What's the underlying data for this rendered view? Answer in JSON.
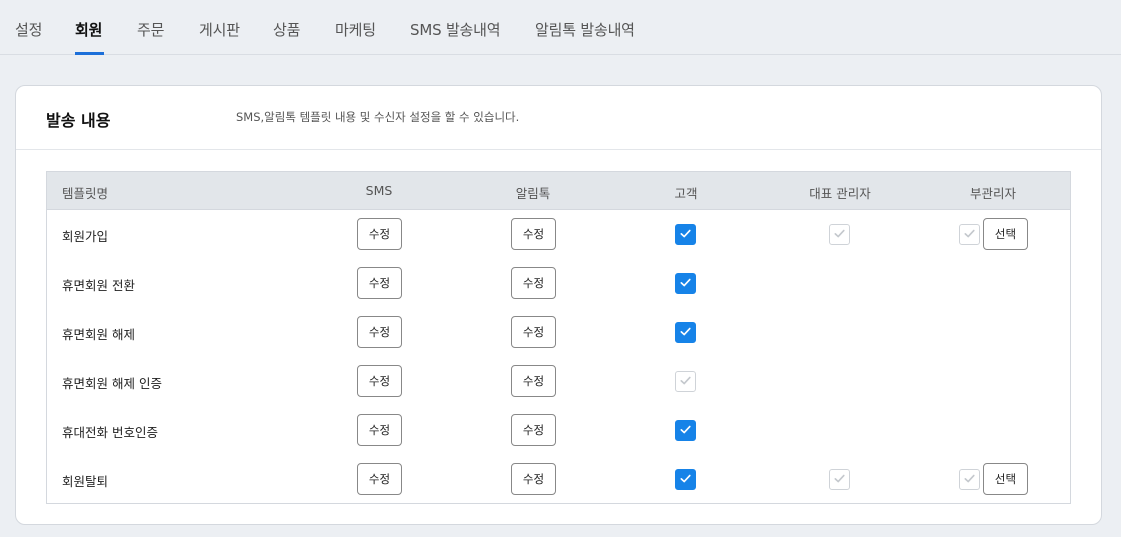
{
  "tabs": [
    {
      "label": "설정",
      "active": false
    },
    {
      "label": "회원",
      "active": true
    },
    {
      "label": "주문",
      "active": false
    },
    {
      "label": "게시판",
      "active": false
    },
    {
      "label": "상품",
      "active": false
    },
    {
      "label": "마케팅",
      "active": false
    },
    {
      "label": "SMS 발송내역",
      "active": false
    },
    {
      "label": "알림톡 발송내역",
      "active": false
    }
  ],
  "section": {
    "title": "발송 내용",
    "description": "SMS,알림톡 템플릿 내용 및 수신자 설정을 할 수 있습니다."
  },
  "columns": [
    "템플릿명",
    "SMS",
    "알림톡",
    "고객",
    "대표 관리자",
    "부관리자"
  ],
  "colors": {
    "accent": "#1683e8",
    "tab_indicator": "#1c6fd9"
  },
  "rows": [
    {
      "name": "회원가입",
      "sms_button": "수정",
      "alimtalk_button": "수정",
      "customer_checked": true,
      "show_admin": true,
      "admin_checked": false,
      "show_subadmin": true,
      "subadmin_checked": false,
      "select_button": "선택"
    },
    {
      "name": "휴면회원 전환",
      "sms_button": "수정",
      "alimtalk_button": "수정",
      "customer_checked": true,
      "show_admin": false,
      "show_subadmin": false
    },
    {
      "name": "휴면회원 해제",
      "sms_button": "수정",
      "alimtalk_button": "수정",
      "customer_checked": true,
      "show_admin": false,
      "show_subadmin": false
    },
    {
      "name": "휴면회원 해제 인증",
      "sms_button": "수정",
      "alimtalk_button": "수정",
      "customer_checked": false,
      "show_admin": false,
      "show_subadmin": false
    },
    {
      "name": "휴대전화 번호인증",
      "sms_button": "수정",
      "alimtalk_button": "수정",
      "customer_checked": true,
      "show_admin": false,
      "show_subadmin": false
    },
    {
      "name": "회원탈퇴",
      "sms_button": "수정",
      "alimtalk_button": "수정",
      "customer_checked": true,
      "show_admin": true,
      "admin_checked": false,
      "show_subadmin": true,
      "subadmin_checked": false,
      "select_button": "선택"
    }
  ]
}
